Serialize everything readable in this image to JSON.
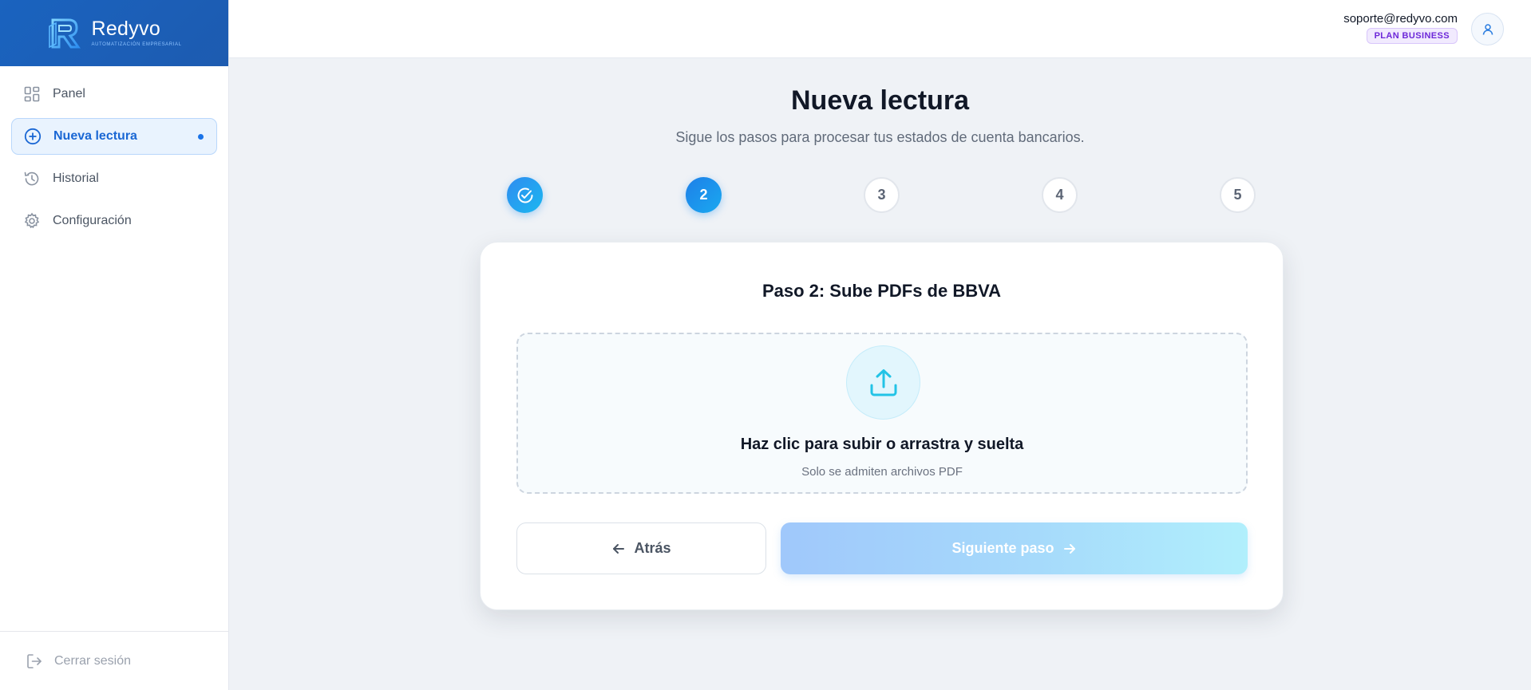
{
  "brand": {
    "name": "Redyvo",
    "tagline": "AUTOMATIZACIÓN EMPRESARIAL",
    "colors": {
      "primary": "#1a63bf",
      "accent": "#1a73e8"
    }
  },
  "sidebar": {
    "items": [
      {
        "label": "Panel",
        "icon": "grid-icon",
        "active": false
      },
      {
        "label": "Nueva lectura",
        "icon": "plus-circle-icon",
        "active": true
      },
      {
        "label": "Historial",
        "icon": "history-icon",
        "active": false
      },
      {
        "label": "Configuración",
        "icon": "gear-icon",
        "active": false
      }
    ],
    "logout_label": "Cerrar sesión"
  },
  "header": {
    "email": "soporte@redyvo.com",
    "plan": "PLAN BUSINESS"
  },
  "page": {
    "title": "Nueva lectura",
    "subtitle": "Sigue los pasos para procesar tus estados de cuenta bancarios."
  },
  "stepper": {
    "current": 2,
    "steps": [
      {
        "label": "",
        "state": "done"
      },
      {
        "label": "2",
        "state": "current"
      },
      {
        "label": "3",
        "state": "pending"
      },
      {
        "label": "4",
        "state": "pending"
      },
      {
        "label": "5",
        "state": "pending"
      }
    ]
  },
  "card": {
    "title": "Paso 2: Sube PDFs de BBVA",
    "dropzone_title": "Haz clic para subir o arrastra y suelta",
    "dropzone_hint": "Solo se admiten archivos PDF",
    "back_label": "Atrás",
    "next_label": "Siguiente paso"
  }
}
